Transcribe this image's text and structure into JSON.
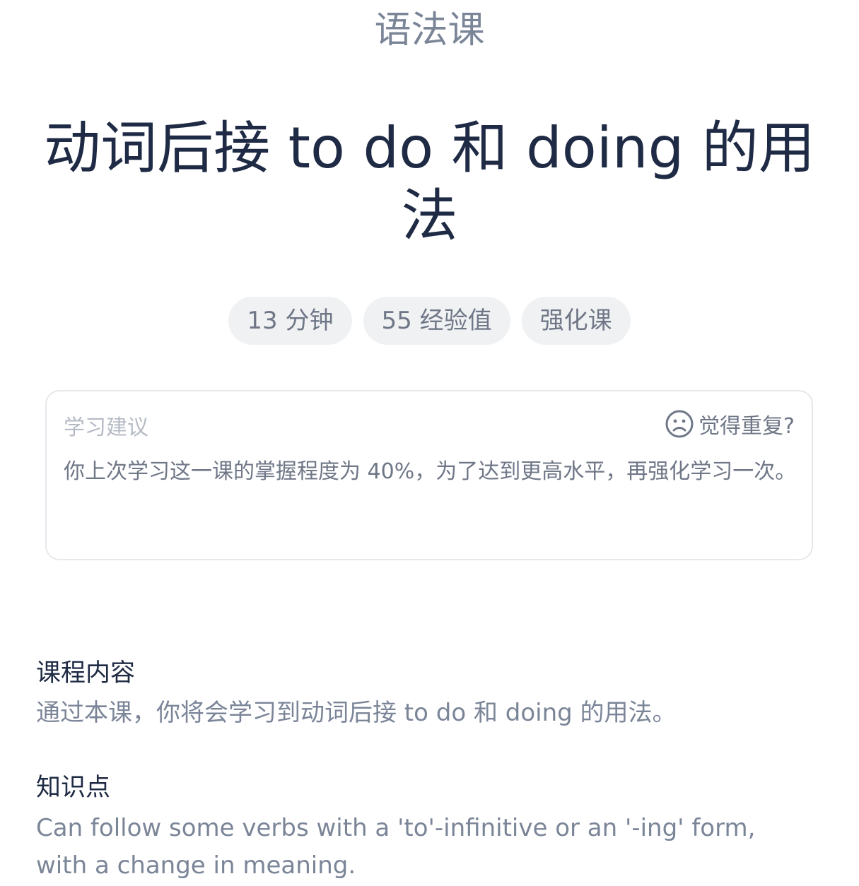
{
  "header": {
    "course_type": "语法课"
  },
  "lesson": {
    "title": "动词后接 to do 和 doing 的用法"
  },
  "tags": [
    {
      "label": "13 分钟"
    },
    {
      "label": "55 经验值"
    },
    {
      "label": "强化课"
    }
  ],
  "advice": {
    "label": "学习建议",
    "repeat_label": "觉得重复?",
    "repeat_icon": "sad-face-icon",
    "text": "你上次学习这一课的掌握程度为 40%，为了达到更高水平，再强化学习一次。"
  },
  "course_content": {
    "heading": "课程内容",
    "body": "通过本课，你将会学习到动词后接 to do 和 doing 的用法。"
  },
  "knowledge_point": {
    "heading": "知识点",
    "body": "Can follow some verbs with a 'to'-infinitive or an '-ing' form, with a change in meaning."
  }
}
